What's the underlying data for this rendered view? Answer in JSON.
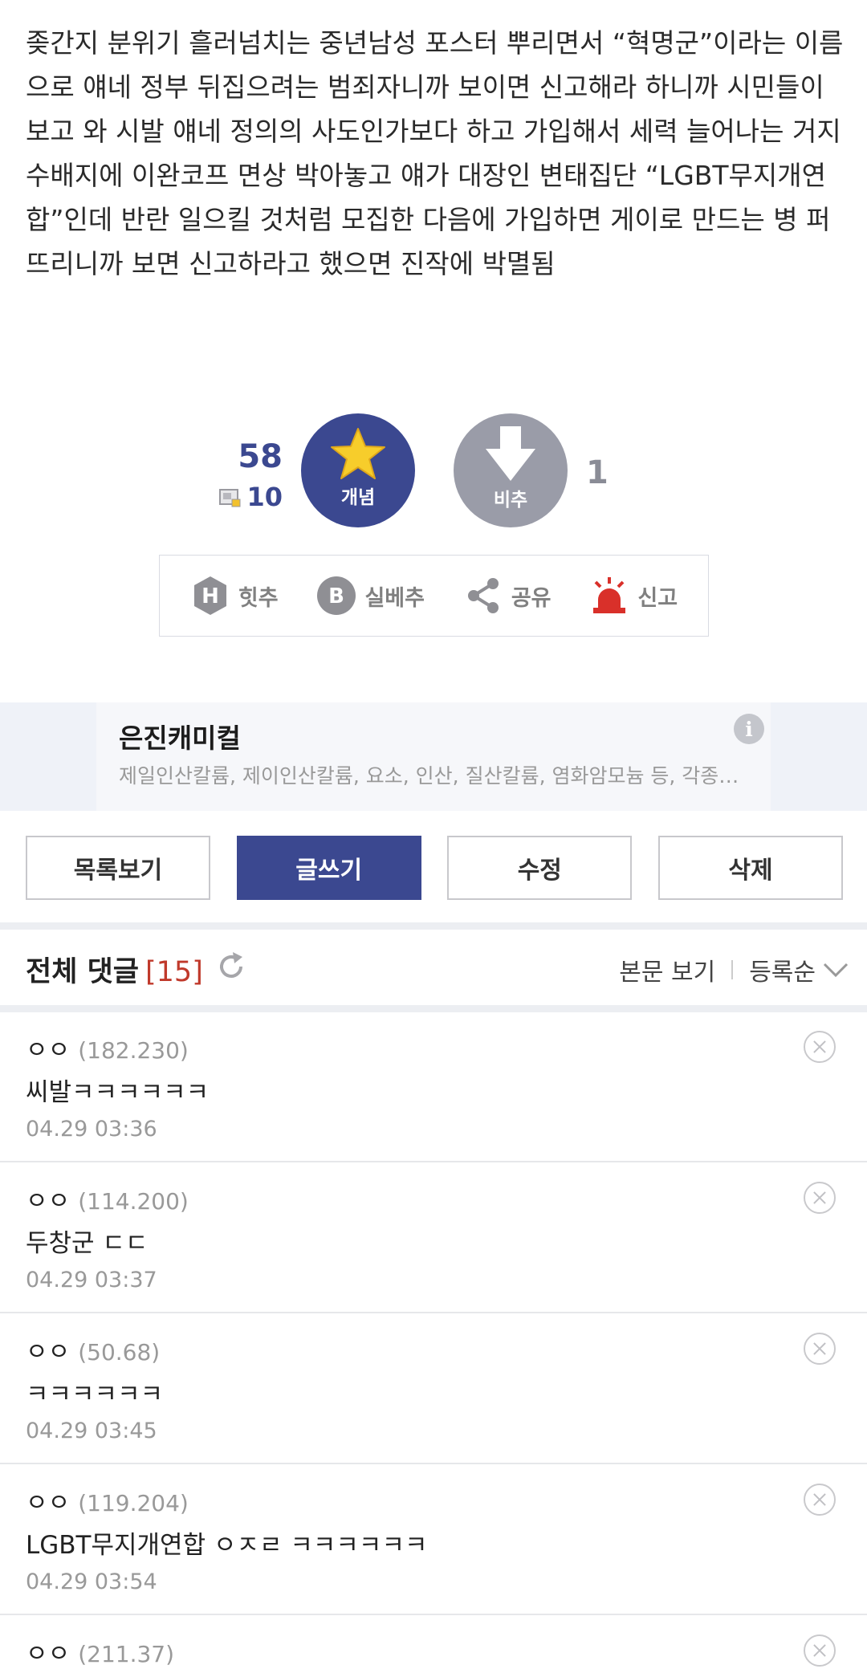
{
  "post": {
    "body": "좆간지 분위기 흘러넘치는 중년남성 포스터 뿌리면서 “혁명군”이라는 이름으로 얘네 정부 뒤집으려는 범죄자니까 보이면 신고해라 하니까 시민들이 보고 와 시발 얘네 정의의 사도인가보다 하고 가입해서 세력 늘어나는 거지\n수배지에 이완코프 면상 박아놓고 얘가 대장인 변태집단 “LGBT무지개연합”인데 반란 일으킬 것처럼 모집한 다음에 가입하면 게이로 만드는 병 퍼뜨리니까 보면 신고하라고 했으면 진작에 박멸됨"
  },
  "vote": {
    "up_count": "58",
    "fix_count": "10",
    "up_label": "개념",
    "down_label": "비추",
    "down_count": "1",
    "up_color": "#3b4890",
    "down_color": "#9a9ca8"
  },
  "actions": [
    {
      "label": "힛추",
      "icon": "hit-recommend-icon"
    },
    {
      "label": "실베추",
      "icon": "best-recommend-icon"
    },
    {
      "label": "공유",
      "icon": "share-icon"
    },
    {
      "label": "신고",
      "icon": "siren-icon"
    }
  ],
  "ad": {
    "title": "은진캐미컬",
    "description": "제일인산칼륨, 제이인산칼륨, 요소, 인산, 질산칼륨, 염화암모늄 등, 각종…",
    "info_icon": "i"
  },
  "buttons": {
    "list": "목록보기",
    "write": "글쓰기",
    "edit": "수정",
    "delete": "삭제"
  },
  "comments_header": {
    "title": "전체 댓글",
    "count": "[15]",
    "view_post": "본문 보기",
    "sort": "등록순"
  },
  "comments": [
    {
      "nick": "ㅇㅇ",
      "ip": "(182.230)",
      "text": "씨발ㅋㅋㅋㅋㅋㅋ",
      "date": "04.29 03:36"
    },
    {
      "nick": "ㅇㅇ",
      "ip": "(114.200)",
      "text": "두창군 ㄷㄷ",
      "date": "04.29 03:37"
    },
    {
      "nick": "ㅇㅇ",
      "ip": "(50.68)",
      "text": "ㅋㅋㅋㅋㅋㅋ",
      "date": "04.29 03:45"
    },
    {
      "nick": "ㅇㅇ",
      "ip": "(119.204)",
      "text": "LGBT무지개연합 ㅇㅈㄹ ㅋㅋㅋㅋㅋㅋ",
      "date": "04.29 03:54"
    },
    {
      "nick": "ㅇㅇ",
      "ip": "(211.37)",
      "text": "",
      "date": ""
    }
  ],
  "accent_color": "#3b4890",
  "count_color": "#c0392b"
}
